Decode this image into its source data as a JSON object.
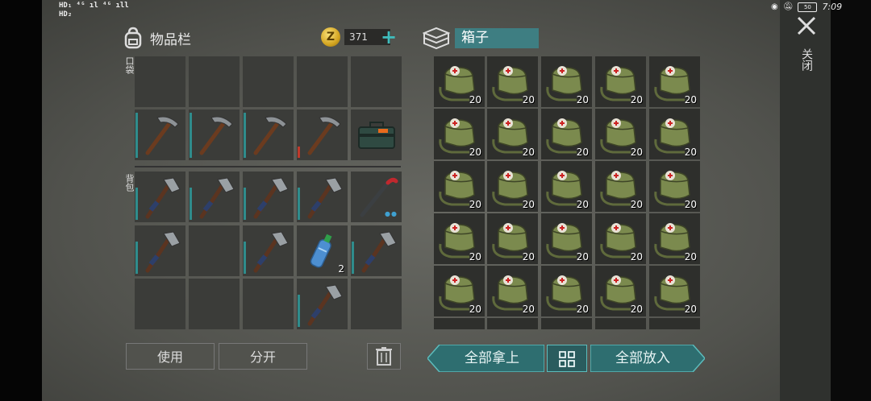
{
  "status_bar": {
    "left_line1": "HD₁ ⁴ᴳ ıl ⁴ᴳ ıll",
    "left_line2": "HD₂",
    "battery": "50",
    "time": "7:09"
  },
  "inventory": {
    "title": "物品栏",
    "pocket_label": "口袋",
    "backpack_label": "背包",
    "coins": "371",
    "pocket_rows": [
      [
        "",
        "",
        "",
        "",
        ""
      ],
      [
        "pickaxe",
        "pickaxe",
        "pickaxe",
        "pickaxe",
        "toolbox"
      ]
    ],
    "backpack_rows": [
      [
        "hatchet",
        "hatchet",
        "hatchet",
        "hatchet",
        "crowbar"
      ],
      [
        "hatchet",
        "",
        "hatchet",
        "bottle",
        "hatchet"
      ],
      [
        "",
        "",
        "",
        "hatchet",
        ""
      ]
    ],
    "bottle_count": "2",
    "use_button": "使用",
    "split_button": "分开"
  },
  "box": {
    "title": "箱子",
    "item_count": "20",
    "rows": 5,
    "cols": 5,
    "take_all_button": "全部拿上",
    "put_all_button": "全部放入"
  },
  "close": {
    "label": "关闭"
  },
  "colors": {
    "accent_teal": "#3e7e82",
    "durability": "#2f8c8c",
    "durability_low": "#c0392b"
  }
}
